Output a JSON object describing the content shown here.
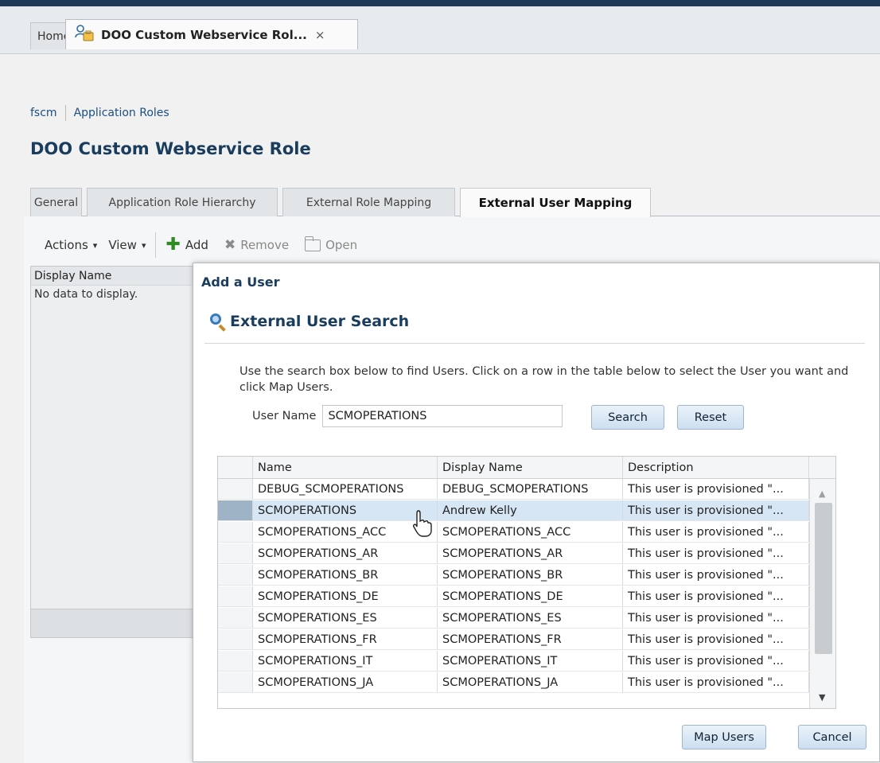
{
  "tabs_bar": {
    "home_label": "Home",
    "doc_tab_label": "DOO Custom Webservice Rol...",
    "doc_tab_close": "×"
  },
  "breadcrumb": {
    "items": [
      "fscm",
      "Application Roles"
    ]
  },
  "page": {
    "title": "DOO Custom Webservice Role",
    "tabs": [
      {
        "label": "General",
        "active": false
      },
      {
        "label": "Application Role Hierarchy",
        "active": false
      },
      {
        "label": "External Role Mapping",
        "active": false
      },
      {
        "label": "External User Mapping",
        "active": true
      }
    ]
  },
  "toolbar": {
    "actions_label": "Actions",
    "view_label": "View",
    "add_label": "Add",
    "remove_label": "Remove",
    "open_label": "Open",
    "caret": "▾"
  },
  "mapping_table": {
    "column": "Display Name",
    "empty_text": "No data to display."
  },
  "dialog": {
    "title": "Add a User",
    "section_title": "External User Search",
    "instructions": "Use the search box below to find Users. Click on a row in the table below to select the User you want and click Map Users.",
    "user_name_label": "User Name",
    "user_name_value": "SCMOPERATIONS",
    "search_button": "Search",
    "reset_button": "Reset",
    "columns": [
      "Name",
      "Display Name",
      "Description"
    ],
    "rows": [
      {
        "name": "DEBUG_SCMOPERATIONS",
        "display_name": "DEBUG_SCMOPERATIONS",
        "description": "This user is provisioned \"...",
        "selected": false
      },
      {
        "name": "SCMOPERATIONS",
        "display_name": "Andrew Kelly",
        "description": "This user is provisioned \"...",
        "selected": true
      },
      {
        "name": "SCMOPERATIONS_ACC",
        "display_name": "SCMOPERATIONS_ACC",
        "description": "This user is provisioned \"...",
        "selected": false
      },
      {
        "name": "SCMOPERATIONS_AR",
        "display_name": "SCMOPERATIONS_AR",
        "description": "This user is provisioned \"...",
        "selected": false
      },
      {
        "name": "SCMOPERATIONS_BR",
        "display_name": "SCMOPERATIONS_BR",
        "description": "This user is provisioned \"...",
        "selected": false
      },
      {
        "name": "SCMOPERATIONS_DE",
        "display_name": "SCMOPERATIONS_DE",
        "description": "This user is provisioned \"...",
        "selected": false
      },
      {
        "name": "SCMOPERATIONS_ES",
        "display_name": "SCMOPERATIONS_ES",
        "description": "This user is provisioned \"...",
        "selected": false
      },
      {
        "name": "SCMOPERATIONS_FR",
        "display_name": "SCMOPERATIONS_FR",
        "description": "This user is provisioned \"...",
        "selected": false
      },
      {
        "name": "SCMOPERATIONS_IT",
        "display_name": "SCMOPERATIONS_IT",
        "description": "This user is provisioned \"...",
        "selected": false
      },
      {
        "name": "SCMOPERATIONS_JA",
        "display_name": "SCMOPERATIONS_JA",
        "description": "This user is provisioned \"...",
        "selected": false
      }
    ],
    "scroll_up": "▲",
    "scroll_down": "▼",
    "map_users_button": "Map Users",
    "cancel_button": "Cancel"
  },
  "colors": {
    "title_blue": "#1a3d5e",
    "link_blue": "#1d4f80",
    "selected_row": "#d7e6f4",
    "button_top": "#eaf2fa",
    "button_bottom": "#cddff0",
    "add_green": "#2e8b22"
  },
  "icons": {
    "doc_tab": "role-people-icon",
    "add": "plus-icon",
    "remove": "remove-icon",
    "open": "folder-icon",
    "search": "magnifier-icon",
    "pointer": "mouse-cursor-icon"
  }
}
